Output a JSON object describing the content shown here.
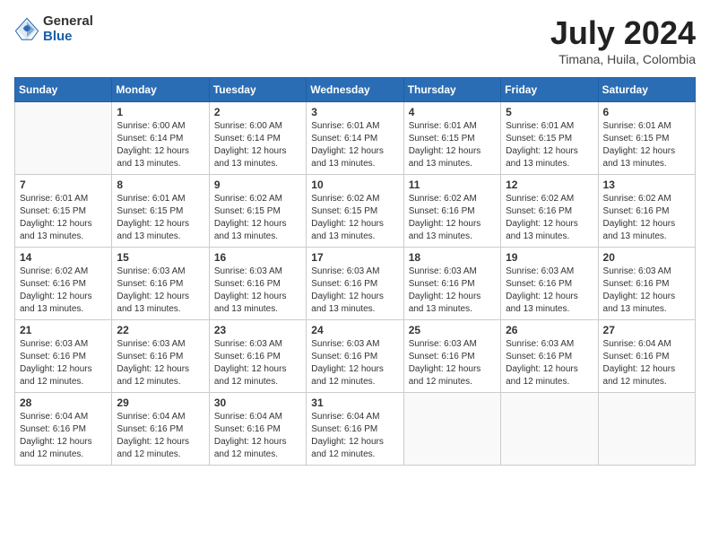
{
  "header": {
    "logo": {
      "general": "General",
      "blue": "Blue"
    },
    "title": "July 2024",
    "location": "Timana, Huila, Colombia"
  },
  "days_of_week": [
    "Sunday",
    "Monday",
    "Tuesday",
    "Wednesday",
    "Thursday",
    "Friday",
    "Saturday"
  ],
  "weeks": [
    [
      {
        "day": "",
        "info": ""
      },
      {
        "day": "1",
        "info": "Sunrise: 6:00 AM\nSunset: 6:14 PM\nDaylight: 12 hours\nand 13 minutes."
      },
      {
        "day": "2",
        "info": "Sunrise: 6:00 AM\nSunset: 6:14 PM\nDaylight: 12 hours\nand 13 minutes."
      },
      {
        "day": "3",
        "info": "Sunrise: 6:01 AM\nSunset: 6:14 PM\nDaylight: 12 hours\nand 13 minutes."
      },
      {
        "day": "4",
        "info": "Sunrise: 6:01 AM\nSunset: 6:15 PM\nDaylight: 12 hours\nand 13 minutes."
      },
      {
        "day": "5",
        "info": "Sunrise: 6:01 AM\nSunset: 6:15 PM\nDaylight: 12 hours\nand 13 minutes."
      },
      {
        "day": "6",
        "info": "Sunrise: 6:01 AM\nSunset: 6:15 PM\nDaylight: 12 hours\nand 13 minutes."
      }
    ],
    [
      {
        "day": "7",
        "info": "Sunrise: 6:01 AM\nSunset: 6:15 PM\nDaylight: 12 hours\nand 13 minutes."
      },
      {
        "day": "8",
        "info": "Sunrise: 6:01 AM\nSunset: 6:15 PM\nDaylight: 12 hours\nand 13 minutes."
      },
      {
        "day": "9",
        "info": "Sunrise: 6:02 AM\nSunset: 6:15 PM\nDaylight: 12 hours\nand 13 minutes."
      },
      {
        "day": "10",
        "info": "Sunrise: 6:02 AM\nSunset: 6:15 PM\nDaylight: 12 hours\nand 13 minutes."
      },
      {
        "day": "11",
        "info": "Sunrise: 6:02 AM\nSunset: 6:16 PM\nDaylight: 12 hours\nand 13 minutes."
      },
      {
        "day": "12",
        "info": "Sunrise: 6:02 AM\nSunset: 6:16 PM\nDaylight: 12 hours\nand 13 minutes."
      },
      {
        "day": "13",
        "info": "Sunrise: 6:02 AM\nSunset: 6:16 PM\nDaylight: 12 hours\nand 13 minutes."
      }
    ],
    [
      {
        "day": "14",
        "info": "Sunrise: 6:02 AM\nSunset: 6:16 PM\nDaylight: 12 hours\nand 13 minutes."
      },
      {
        "day": "15",
        "info": "Sunrise: 6:03 AM\nSunset: 6:16 PM\nDaylight: 12 hours\nand 13 minutes."
      },
      {
        "day": "16",
        "info": "Sunrise: 6:03 AM\nSunset: 6:16 PM\nDaylight: 12 hours\nand 13 minutes."
      },
      {
        "day": "17",
        "info": "Sunrise: 6:03 AM\nSunset: 6:16 PM\nDaylight: 12 hours\nand 13 minutes."
      },
      {
        "day": "18",
        "info": "Sunrise: 6:03 AM\nSunset: 6:16 PM\nDaylight: 12 hours\nand 13 minutes."
      },
      {
        "day": "19",
        "info": "Sunrise: 6:03 AM\nSunset: 6:16 PM\nDaylight: 12 hours\nand 13 minutes."
      },
      {
        "day": "20",
        "info": "Sunrise: 6:03 AM\nSunset: 6:16 PM\nDaylight: 12 hours\nand 13 minutes."
      }
    ],
    [
      {
        "day": "21",
        "info": "Sunrise: 6:03 AM\nSunset: 6:16 PM\nDaylight: 12 hours\nand 12 minutes."
      },
      {
        "day": "22",
        "info": "Sunrise: 6:03 AM\nSunset: 6:16 PM\nDaylight: 12 hours\nand 12 minutes."
      },
      {
        "day": "23",
        "info": "Sunrise: 6:03 AM\nSunset: 6:16 PM\nDaylight: 12 hours\nand 12 minutes."
      },
      {
        "day": "24",
        "info": "Sunrise: 6:03 AM\nSunset: 6:16 PM\nDaylight: 12 hours\nand 12 minutes."
      },
      {
        "day": "25",
        "info": "Sunrise: 6:03 AM\nSunset: 6:16 PM\nDaylight: 12 hours\nand 12 minutes."
      },
      {
        "day": "26",
        "info": "Sunrise: 6:03 AM\nSunset: 6:16 PM\nDaylight: 12 hours\nand 12 minutes."
      },
      {
        "day": "27",
        "info": "Sunrise: 6:04 AM\nSunset: 6:16 PM\nDaylight: 12 hours\nand 12 minutes."
      }
    ],
    [
      {
        "day": "28",
        "info": "Sunrise: 6:04 AM\nSunset: 6:16 PM\nDaylight: 12 hours\nand 12 minutes."
      },
      {
        "day": "29",
        "info": "Sunrise: 6:04 AM\nSunset: 6:16 PM\nDaylight: 12 hours\nand 12 minutes."
      },
      {
        "day": "30",
        "info": "Sunrise: 6:04 AM\nSunset: 6:16 PM\nDaylight: 12 hours\nand 12 minutes."
      },
      {
        "day": "31",
        "info": "Sunrise: 6:04 AM\nSunset: 6:16 PM\nDaylight: 12 hours\nand 12 minutes."
      },
      {
        "day": "",
        "info": ""
      },
      {
        "day": "",
        "info": ""
      },
      {
        "day": "",
        "info": ""
      }
    ]
  ]
}
